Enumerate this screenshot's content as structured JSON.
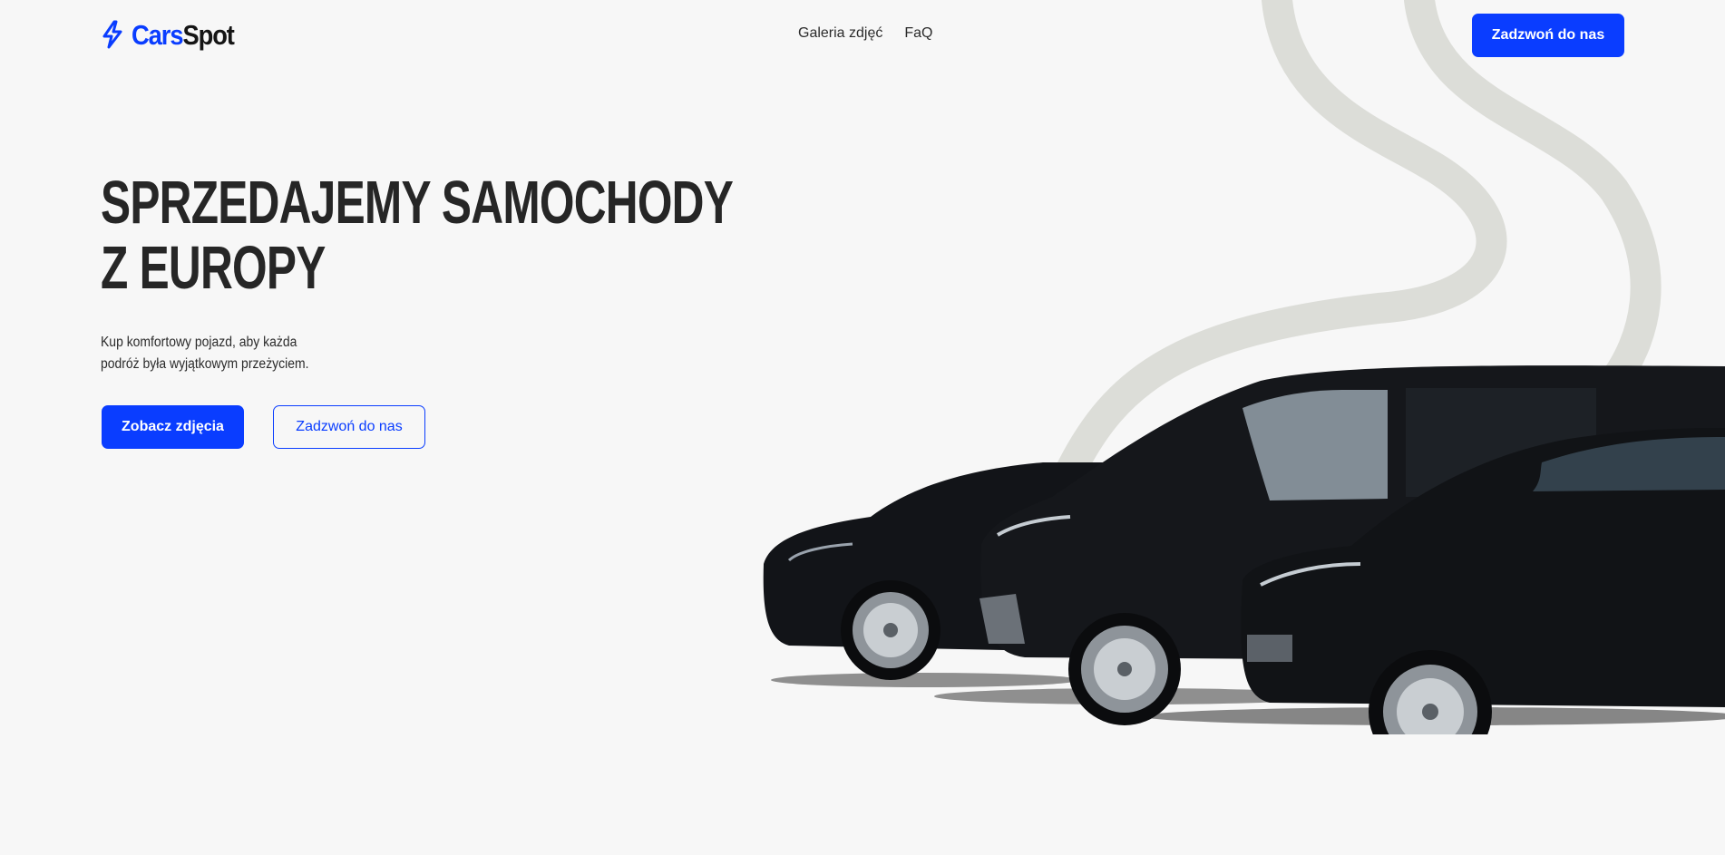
{
  "brand": {
    "name_part1": "Cars",
    "name_part2": "Spot",
    "icon": "lightning-bolt-icon",
    "accent_color": "#0a3dff"
  },
  "nav": {
    "items": [
      {
        "label": "Galeria zdjęć"
      },
      {
        "label": "FaQ"
      }
    ]
  },
  "header": {
    "call_button": "Zadzwoń do nas"
  },
  "hero": {
    "title_line1": "SPRZEDAJEMY SAMOCHODY",
    "title_line2": "Z EUROPY",
    "subtitle_line1": "Kup komfortowy pojazd, aby każda",
    "subtitle_line2": "podróż była wyjątkowym przeżyciem.",
    "primary_button": "Zobacz zdjęcia",
    "secondary_button": "Zadzwoń do nas"
  },
  "colors": {
    "background": "#f7f7f7",
    "swirl": "#dcddd8",
    "text": "#262626"
  }
}
